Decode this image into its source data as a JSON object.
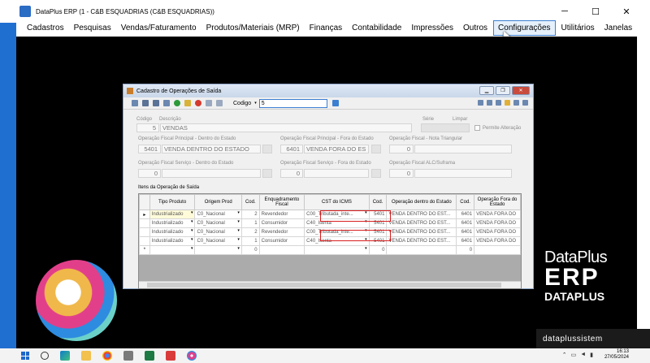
{
  "window": {
    "title": "DataPlus ERP (1 - C&B ESQUADRIAS  (C&B ESQUADRIAS))"
  },
  "menu": [
    "Cadastros",
    "Pesquisas",
    "Vendas/Faturamento",
    "Produtos/Materiais (MRP)",
    "Finanças",
    "Contabilidade",
    "Impressões",
    "Outros",
    "Configurações",
    "Utilitários",
    "Janelas"
  ],
  "dialog": {
    "title": "Cadastro de Operações de Saída",
    "codigo_label": "Codigo",
    "codigo_value": "5",
    "codigo_lbl": "Código",
    "descricao_lbl": "Descrição",
    "codigo_field": "5",
    "descricao_field": "VENDAS",
    "serie_lbl": "Série",
    "limpar_lbl": "Limpar",
    "permite_lbl": "Permite Alteração",
    "op_dentro_lbl": "Operação Fiscal Principal - Dentro do Estado",
    "op_dentro_code": "5401",
    "op_dentro_desc": "VENDA DENTRO DO ESTADO",
    "op_fora_lbl": "Operação Fiscal Principal - Fora do Estado",
    "op_fora_code": "6401",
    "op_fora_desc": "VENDA FORA DO ES",
    "nota_tri_lbl": "Operação Fiscal - Nota Triangular",
    "nota_tri_code": "0",
    "serv_dentro_lbl": "Operação Fiscal Serviço - Dentro do Estado",
    "serv_dentro_code": "0",
    "serv_fora_lbl": "Operação Fiscal Serviço - Fora do Estado",
    "serv_fora_code": "0",
    "alc_lbl": "Operação Fiscal ALC/Suframa",
    "alc_code": "0",
    "itens_lbl": "Itens da Operação de Saída"
  },
  "grid": {
    "headers": [
      "Tipo Produto",
      "Origem Prod",
      "Cod.",
      "Enquadramento Fiscal",
      "CST do ICMS",
      "Cod.",
      "Operação dentro do Estado",
      "Cod.",
      "Operação Fora do Estado"
    ],
    "rows": [
      {
        "marker": "▸",
        "tipo": "Industrializado",
        "origem": "C0_Nacional",
        "cod": "2",
        "enq": "Revendedor",
        "cst": "C00_Tributada_inte...",
        "cod2": "5401",
        "op_dentro": "VENDA DENTRO DO EST...",
        "cod3": "6401",
        "op_fora": "VENDA FORA DO"
      },
      {
        "marker": "",
        "tipo": "Industrializado",
        "origem": "C0_Nacional",
        "cod": "1",
        "enq": "Consumidor",
        "cst": "C40_Isenta",
        "cod2": "5401",
        "op_dentro": "VENDA DENTRO DO EST...",
        "cod3": "6401",
        "op_fora": "VENDA FORA DO"
      },
      {
        "marker": "",
        "tipo": "Industrializado",
        "origem": "C0_Nacional",
        "cod": "2",
        "enq": "Revendedor",
        "cst": "C00_Tributada_inte...",
        "cod2": "5401",
        "op_dentro": "VENDA DENTRO DO EST...",
        "cod3": "6401",
        "op_fora": "VENDA FORA DO"
      },
      {
        "marker": "",
        "tipo": "Industrializado",
        "origem": "C0_Nacional",
        "cod": "1",
        "enq": "Consumidor",
        "cst": "C40_Isenta",
        "cod2": "5401",
        "op_dentro": "VENDA DENTRO DO EST...",
        "cod3": "6401",
        "op_fora": "VENDA FORA DO"
      },
      {
        "marker": "*",
        "tipo": "",
        "origem": "",
        "cod": "0",
        "enq": "",
        "cst": "",
        "cod2": "0",
        "op_dentro": "",
        "cod3": "0",
        "op_fora": ""
      }
    ]
  },
  "branding": {
    "dataplus": "DataPlus",
    "erp": "ERP",
    "datap": "DATAPLUS",
    "site": "dataplussistem"
  },
  "taskbar": {
    "time": "16:13",
    "date": "27/05/2024"
  },
  "colors": {
    "accent": "#3c7fd1",
    "highlight_red": "#d81e1e",
    "window_blue": "#1f6fd1"
  }
}
